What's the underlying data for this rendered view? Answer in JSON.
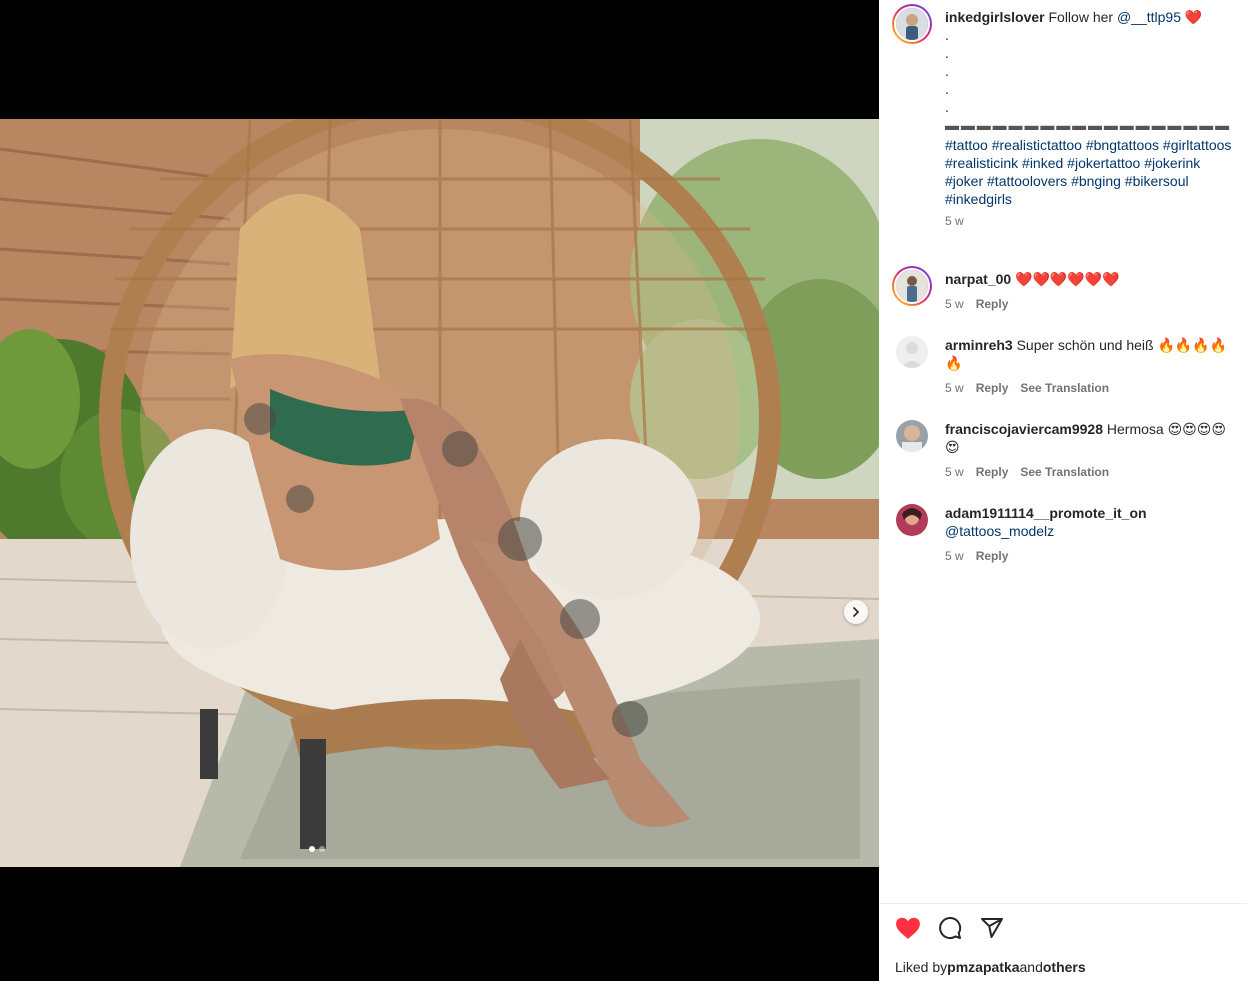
{
  "media": {
    "carousel": {
      "slide_count": 2,
      "active_index": 0
    },
    "next_icon": "chevron-right-icon"
  },
  "caption": {
    "username": "inkedgirlslover",
    "text_before": " Follow her ",
    "mention": "@__ttlp95",
    "heart": "❤️",
    "dots": [
      ".",
      ".",
      ".",
      ".",
      "."
    ],
    "separator": "▬ ▬ ▬ ▬ ▬ ▬ ▬ ▬ ▬ ▬ ▬ ▬ ▬ ▬ ▬ ▬ ▬ ▬",
    "hashtags": "#tattoo #realistictattoo #bngtattoos #girltattoos #realisticink #inked #jokertattoo #jokerink #joker #tattoolovers #bnging #bikersoul #inkedgirls",
    "time": "5 w"
  },
  "comments": [
    {
      "username": "narpat_00",
      "text": "❤️❤️❤️❤️❤️❤️",
      "time": "5 w",
      "reply": "Reply",
      "translate": ""
    },
    {
      "username": "arminreh3",
      "text": "Super schön und heiß 🔥🔥🔥🔥🔥",
      "time": "5 w",
      "reply": "Reply",
      "translate": "See Translation"
    },
    {
      "username": "franciscojaviercam9928",
      "text": "Hermosa 😍😍😍😍😍",
      "time": "5 w",
      "reply": "Reply",
      "translate": "See Translation"
    },
    {
      "username": "adam1911114__promote_it_on",
      "mention": "@tattoos_modelz",
      "time": "5 w",
      "reply": "Reply"
    }
  ],
  "actions": {
    "like_icon": "heart-filled-icon",
    "comment_icon": "comment-icon",
    "share_icon": "share-icon",
    "like_color": "#ff3040"
  },
  "likes": {
    "prefix": "Liked by",
    "user": "pmzapatka",
    "and": "and",
    "others": "others"
  }
}
